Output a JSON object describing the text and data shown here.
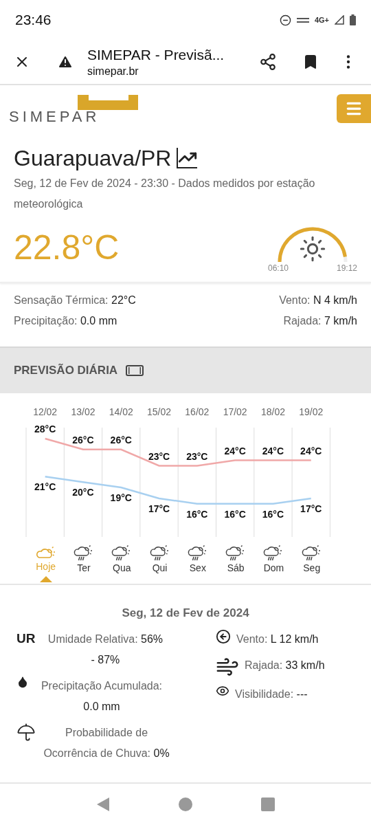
{
  "status_bar": {
    "time": "23:46",
    "network": "4G+"
  },
  "browser": {
    "title": "SIMEPAR - Previsã...",
    "url": "simepar.br"
  },
  "site_header": {
    "logo": "SIMEPAR"
  },
  "station": {
    "city": "Guarapuava/PR",
    "subtitle": "Seg, 12 de Fev de 2024 - 23:30 - Dados medidos por estação meteorológica",
    "temperature": "22.8°C",
    "sunrise": "06:10",
    "sunset": "19:12"
  },
  "current_stats": {
    "left": [
      {
        "label": "Sensação Térmica:",
        "value": "22°C"
      },
      {
        "label": "Precipitação:",
        "value": "0.0 mm"
      }
    ],
    "right": [
      {
        "label": "Vento:",
        "value": "N 4 km/h"
      },
      {
        "label": "Rajada:",
        "value": "7 km/h"
      }
    ]
  },
  "daily": {
    "title": "PREVISÃO DIÁRIA",
    "chart_data": {
      "type": "line",
      "categories": [
        "12/02",
        "13/02",
        "14/02",
        "15/02",
        "16/02",
        "17/02",
        "18/02",
        "19/02"
      ],
      "series": [
        {
          "color": "#f0a8a8",
          "values": [
            28,
            26,
            26,
            23,
            23,
            24,
            24,
            24
          ],
          "value_labels": [
            "28°C",
            "26°C",
            "26°C",
            "23°C",
            "23°C",
            "24°C",
            "24°C",
            "24°C"
          ]
        },
        {
          "color": "#a8d0f0",
          "values": [
            21,
            20,
            19,
            17,
            16,
            16,
            16,
            17
          ],
          "value_labels": [
            "21°C",
            "20°C",
            "19°C",
            "17°C",
            "16°C",
            "16°C",
            "16°C",
            "17°C"
          ]
        }
      ]
    },
    "days": [
      {
        "name": "Hoje",
        "kind": "cloudy",
        "selected": true
      },
      {
        "name": "Ter",
        "kind": "rain",
        "selected": false
      },
      {
        "name": "Qua",
        "kind": "rain",
        "selected": false
      },
      {
        "name": "Qui",
        "kind": "rain",
        "selected": false
      },
      {
        "name": "Sex",
        "kind": "rain",
        "selected": false
      },
      {
        "name": "Sáb",
        "kind": "rain",
        "selected": false
      },
      {
        "name": "Dom",
        "kind": "rain",
        "selected": false
      },
      {
        "name": "Seg",
        "kind": "rain",
        "selected": false
      }
    ]
  },
  "day_detail": {
    "date": "Seg, 12 de Fev de 2024",
    "humidity_badge": "UR",
    "left": [
      {
        "kind": "humidity",
        "label": "Umidade Relativa:",
        "value": "56% - 87%"
      },
      {
        "kind": "precipitation",
        "label": "Precipitação Acumulada:",
        "value": "0.0 mm"
      },
      {
        "kind": "rain_chance",
        "label": "Probabilidade de Ocorrência de Chuva:",
        "value": "0%"
      }
    ],
    "right": [
      {
        "kind": "wind",
        "label": "Vento:",
        "value": "L 12 km/h"
      },
      {
        "kind": "gust",
        "label": "Rajada:",
        "value": "33 km/h"
      },
      {
        "kind": "visibility",
        "label": "Visibilidade:",
        "value": "---"
      }
    ]
  }
}
